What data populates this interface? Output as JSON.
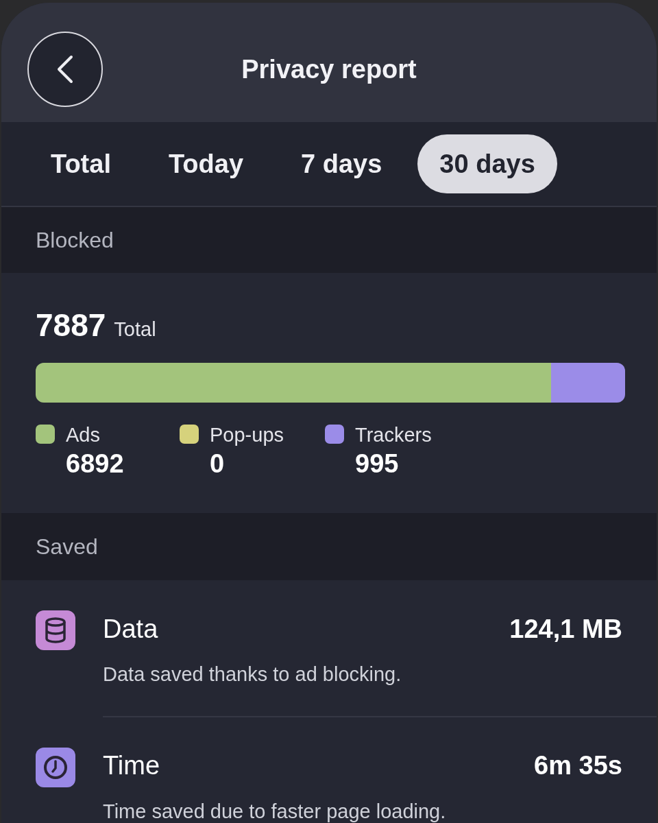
{
  "header": {
    "title": "Privacy report"
  },
  "tabs": [
    {
      "label": "Total",
      "selected": false
    },
    {
      "label": "Today",
      "selected": false
    },
    {
      "label": "7 days",
      "selected": false
    },
    {
      "label": "30 days",
      "selected": true
    }
  ],
  "blocked": {
    "heading": "Blocked",
    "total": "7887",
    "total_label": "Total",
    "categories": [
      {
        "label": "Ads",
        "count": "6892",
        "color": "#a3c47c",
        "level": 0.874
      },
      {
        "label": "Pop-ups",
        "count": "0",
        "color": "#d6d27c",
        "level": 0
      },
      {
        "label": "Trackers",
        "count": "995",
        "color": "#9b8ce8",
        "level": 0.126
      }
    ]
  },
  "saved": {
    "heading": "Saved",
    "items": [
      {
        "kind": "data",
        "title": "Data",
        "value": "124,1 MB",
        "description": "Data saved thanks to ad blocking."
      },
      {
        "kind": "time",
        "title": "Time",
        "value": "6m 35s",
        "description": "Time saved due to faster page loading."
      }
    ]
  }
}
